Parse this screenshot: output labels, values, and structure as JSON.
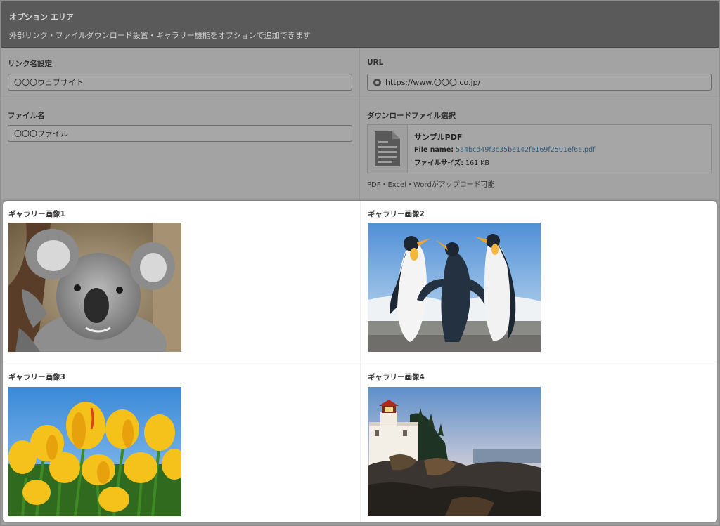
{
  "header": {
    "title": "オプション エリア",
    "description": "外部リンク・ファイルダウンロード設置・ギャラリー機能をオプションで追加できます"
  },
  "link_name": {
    "label": "リンク名設定",
    "value": "〇〇〇ウェブサイト"
  },
  "url": {
    "label": "URL",
    "value": "https://www.〇〇〇.co.jp/",
    "icon": "globe-icon"
  },
  "file_name": {
    "label": "ファイル名",
    "value": "〇〇〇ファイル"
  },
  "download": {
    "label": "ダウンロードファイル選択",
    "file_title": "サンプルPDF",
    "file_name_label": "File name:",
    "file_name_value": "5a4bcd49f3c35be142fe169f2501ef6e.pdf",
    "size_label": "ファイルサイズ:",
    "size_value": "161 KB",
    "note": "PDF・Excel・Wordがアップロード可能",
    "icon": "document-icon"
  },
  "gallery": [
    {
      "label": "ギャラリー画像1",
      "subject": "koala"
    },
    {
      "label": "ギャラリー画像2",
      "subject": "penguins"
    },
    {
      "label": "ギャラリー画像3",
      "subject": "tulips"
    },
    {
      "label": "ギャラリー画像4",
      "subject": "lighthouse"
    }
  ],
  "colors": {
    "header_bg": "#5a5a5a",
    "overlay_bg": "#a3a3a3",
    "link": "#2d5d7e",
    "panel_bg": "#ffffff"
  }
}
